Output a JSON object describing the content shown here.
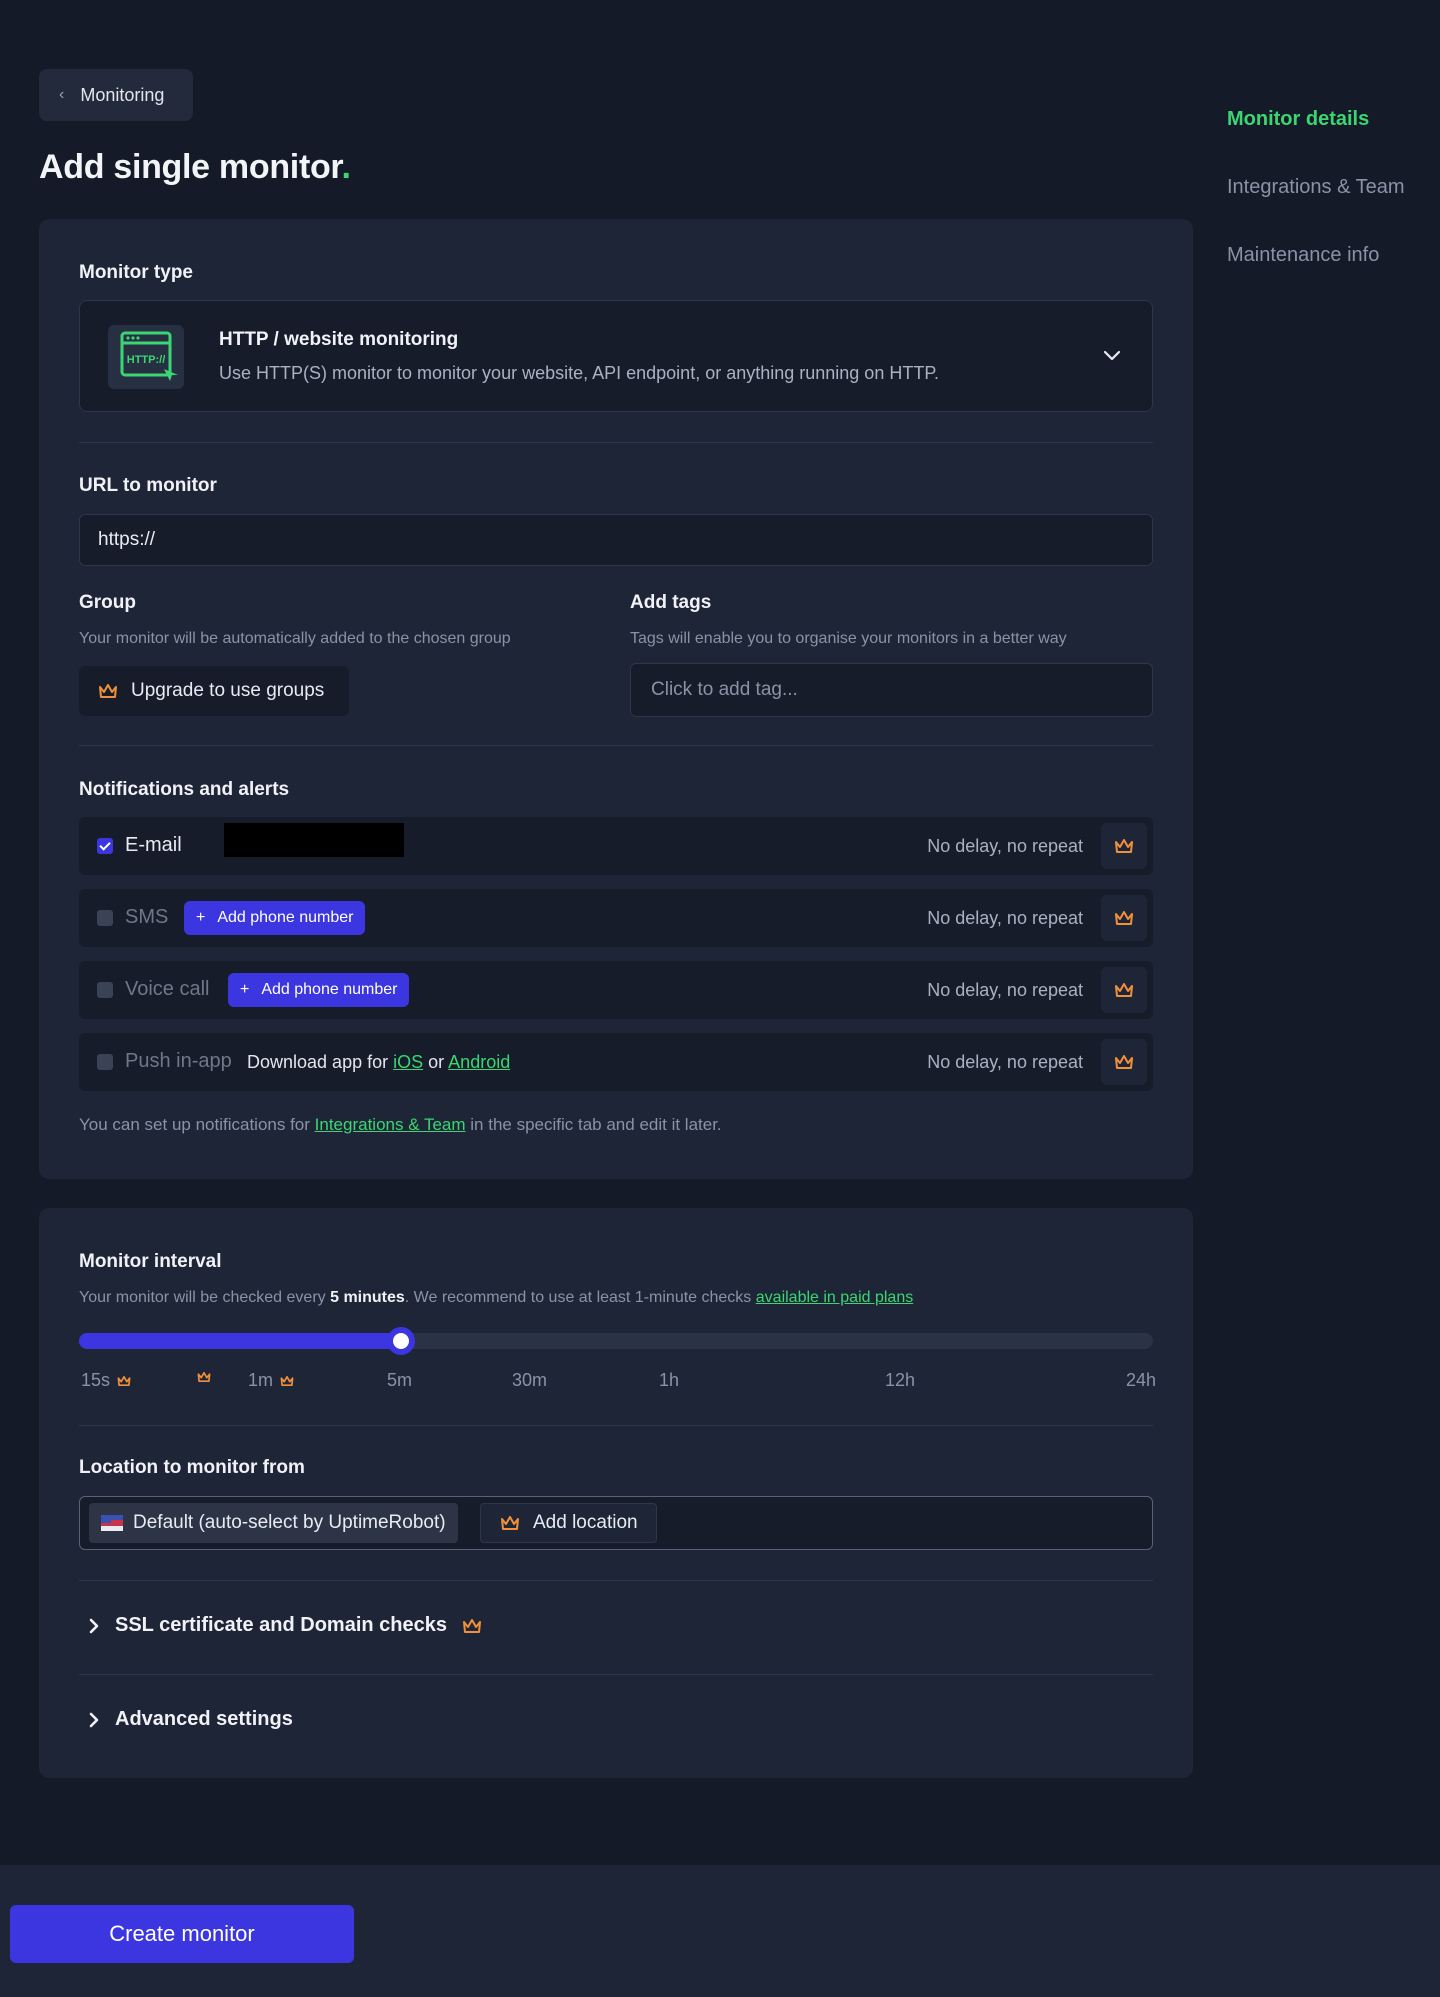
{
  "header": {
    "back_label": "Monitoring",
    "title": "Add single monitor",
    "title_dot": "."
  },
  "side_nav": {
    "items": [
      {
        "label": "Monitor details",
        "active": true
      },
      {
        "label": "Integrations & Team",
        "active": false
      },
      {
        "label": "Maintenance info",
        "active": false
      }
    ]
  },
  "monitor_type": {
    "label": "Monitor type",
    "icon_text": "HTTP://",
    "title": "HTTP / website monitoring",
    "description": "Use HTTP(S) monitor to monitor your website, API endpoint, or anything running on HTTP."
  },
  "url": {
    "label": "URL to monitor",
    "value": "https://"
  },
  "group": {
    "label": "Group",
    "hint": "Your monitor will be automatically added to the chosen group",
    "upgrade_label": "Upgrade to use groups"
  },
  "tags": {
    "label": "Add tags",
    "hint": "Tags will enable you to organise your monitors in a better way",
    "placeholder": "Click to add tag..."
  },
  "notifications": {
    "label": "Notifications and alerts",
    "rows": [
      {
        "label": "E-mail",
        "checked": true,
        "delay": "No delay, no repeat"
      },
      {
        "label": "SMS",
        "checked": false,
        "delay": "No delay, no repeat",
        "action": "Add phone number"
      },
      {
        "label": "Voice call",
        "checked": false,
        "delay": "No delay, no repeat",
        "action": "Add phone number"
      },
      {
        "label": "Push in-app",
        "checked": false,
        "delay": "No delay, no repeat",
        "text_prefix": "Download app for",
        "link_ios": "iOS",
        "text_or": "or",
        "link_android": "Android"
      }
    ],
    "footnote_prefix": "You can set up notifications for",
    "footnote_link": "Integrations & Team",
    "footnote_suffix": "in the specific tab and edit it later."
  },
  "interval": {
    "label": "Monitor interval",
    "hint_prefix": "Your monitor will be checked every",
    "hint_value": "5 minutes",
    "hint_mid": ". We recommend to use at least 1-minute checks",
    "hint_link": "available in paid plans",
    "slider_percent": 30,
    "ticks": [
      "15s",
      "",
      "1m",
      "5m",
      "30m",
      "1h",
      "12h",
      "24h"
    ]
  },
  "location": {
    "label": "Location to monitor from",
    "default_label": "Default (auto-select by UptimeRobot)",
    "add_label": "Add location"
  },
  "ssl": {
    "label": "SSL certificate and Domain checks"
  },
  "advanced": {
    "label": "Advanced settings"
  },
  "footer": {
    "create_label": "Create monitor"
  },
  "colors": {
    "accent": "#3b36e0",
    "green": "#3bd671",
    "crown": "#f0903a",
    "background": "#141a28",
    "card": "#1e2536"
  }
}
